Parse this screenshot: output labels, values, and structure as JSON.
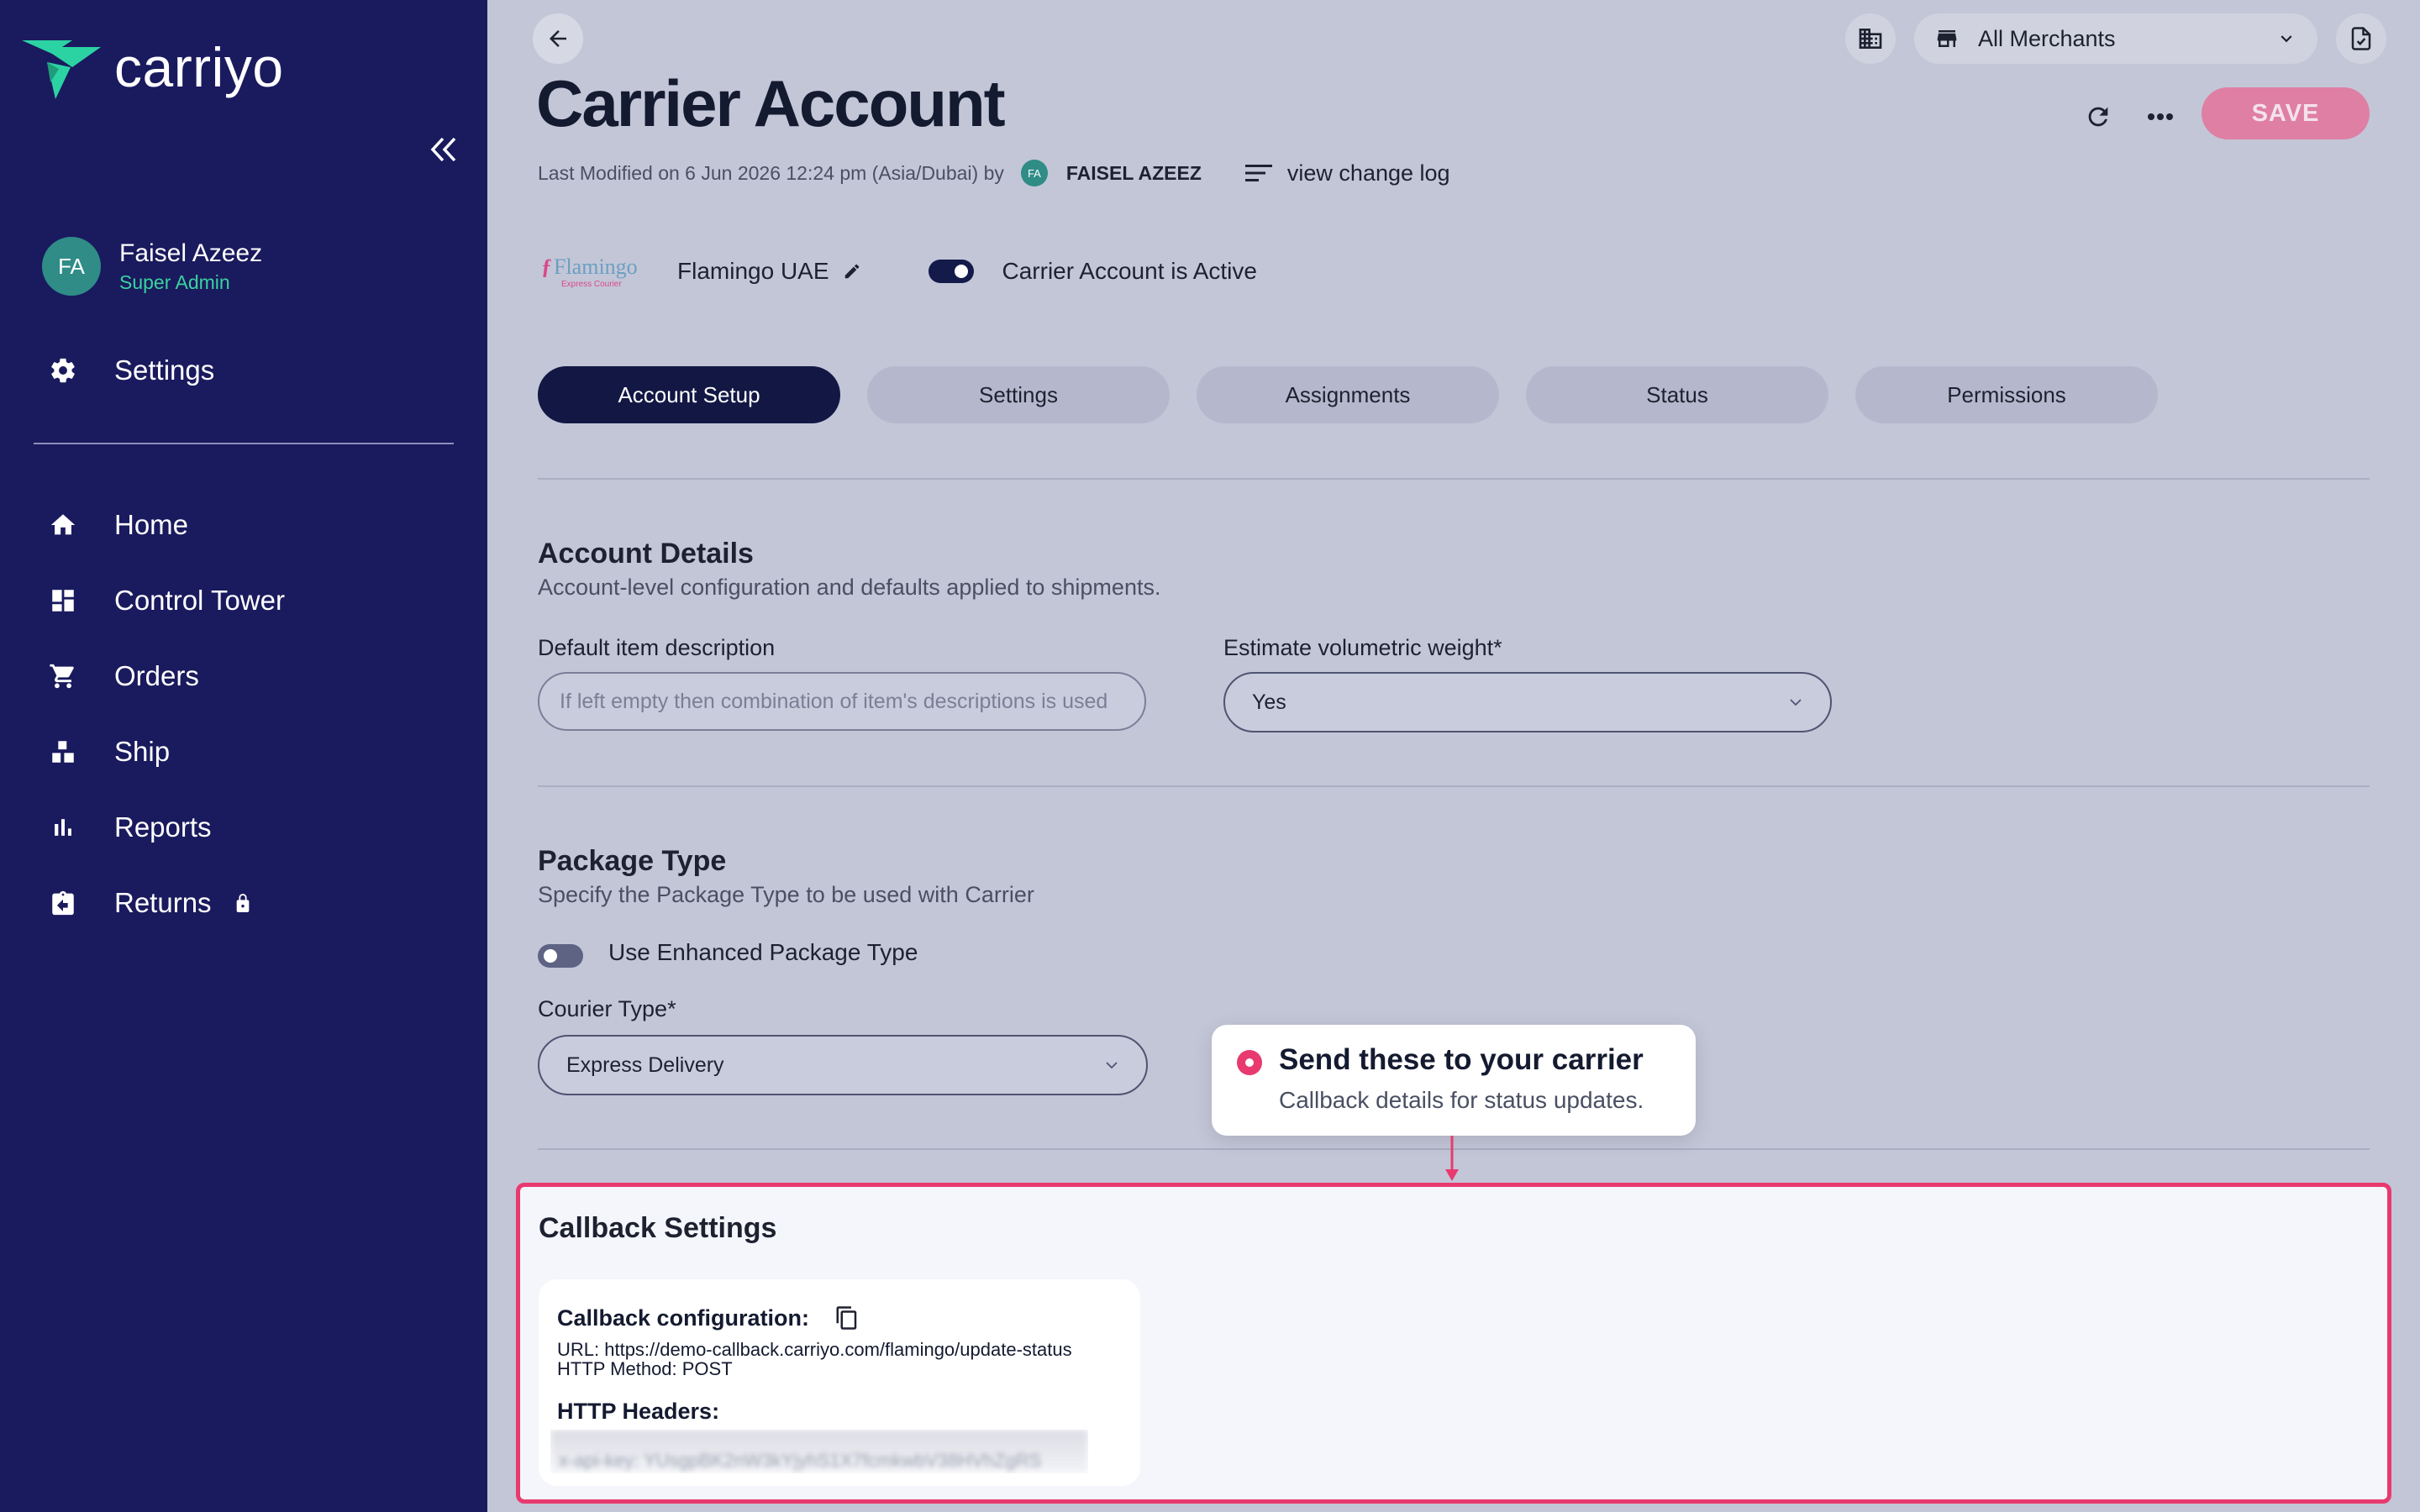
{
  "app": {
    "logo_text": "carriyo"
  },
  "sidebar": {
    "user": {
      "initials": "FA",
      "name": "Faisel Azeez",
      "role": "Super Admin"
    },
    "settings_label": "Settings",
    "items": [
      {
        "label": "Home",
        "icon": "home-icon"
      },
      {
        "label": "Control Tower",
        "icon": "dashboard-icon"
      },
      {
        "label": "Orders",
        "icon": "cart-icon"
      },
      {
        "label": "Ship",
        "icon": "ship-icon"
      },
      {
        "label": "Reports",
        "icon": "bar-chart-icon"
      },
      {
        "label": "Returns",
        "icon": "returns-icon",
        "locked": true
      }
    ]
  },
  "topbar": {
    "merchant_select": "All Merchants"
  },
  "page": {
    "title": "Carrier Account",
    "save_label": "SAVE",
    "modified_text": "Last Modified on 6 Jun 2026 12:24 pm (Asia/Dubai) by",
    "modified_user_initials": "FA",
    "modified_user": "FAISEL AZEEZ",
    "change_log_label": "view change log"
  },
  "carrier": {
    "logo_brand": "Flamingo",
    "logo_tagline": "Express Courier",
    "name": "Flamingo UAE",
    "active": true,
    "active_label": "Carrier Account is Active"
  },
  "tabs": [
    {
      "label": "Account Setup",
      "active": true
    },
    {
      "label": "Settings",
      "active": false
    },
    {
      "label": "Assignments",
      "active": false
    },
    {
      "label": "Status",
      "active": false
    },
    {
      "label": "Permissions",
      "active": false
    }
  ],
  "account_details": {
    "title": "Account Details",
    "subtitle": "Account-level configuration and defaults applied to shipments.",
    "default_item_label": "Default item description",
    "default_item_placeholder": "If left empty then combination of item's descriptions is used",
    "default_item_value": "",
    "volumetric_label": "Estimate volumetric weight*",
    "volumetric_value": "Yes"
  },
  "package_type": {
    "title": "Package Type",
    "subtitle": "Specify the Package Type to be used with Carrier",
    "enhanced_toggle_on": false,
    "enhanced_label": "Use Enhanced Package Type",
    "courier_label": "Courier Type*",
    "courier_value": "Express Delivery"
  },
  "callout": {
    "title": "Send these to your carrier",
    "subtitle": "Callback details for status updates."
  },
  "callback": {
    "title": "Callback Settings",
    "config_title": "Callback configuration:",
    "url_line": "URL: https://demo-callback.carriyo.com/flamingo/update-status",
    "method_line": "HTTP Method: POST",
    "headers_title": "HTTP Headers:",
    "headers_value": "x-api-key: YUsgpBK2nW3kYjyhS1X7fcmkwbV38HVhZgRS"
  },
  "colors": {
    "sidebar_bg": "#1a1a5e",
    "page_bg": "#c3c6d7",
    "accent_pink": "#e83a6f",
    "active_tab": "#121744",
    "save_button": "#de7fa3",
    "role_green": "#3ad29f"
  }
}
